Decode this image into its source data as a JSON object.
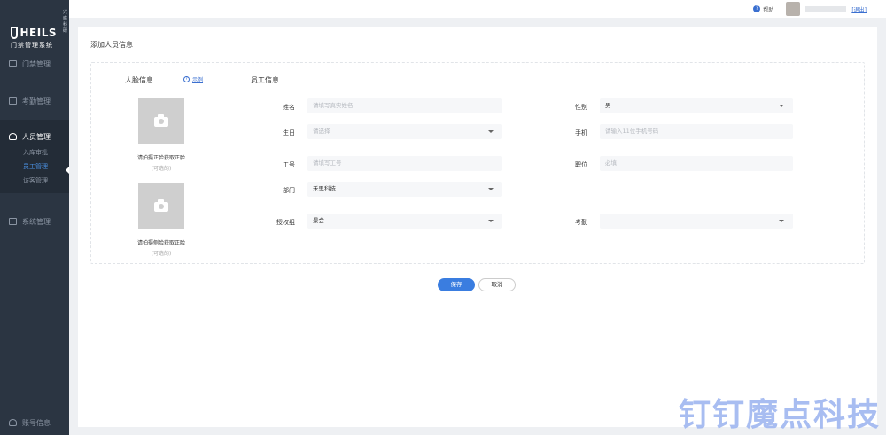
{
  "app": {
    "brand": "HEILS",
    "brand_tagline": "兴盛科研",
    "system_name": "门禁管理系统"
  },
  "sidebar": {
    "items": [
      {
        "label": "门禁管理"
      },
      {
        "label": "考勤管理"
      },
      {
        "label": "人员管理",
        "active": true
      },
      {
        "label": "系统管理"
      }
    ],
    "sub_items": [
      {
        "label": "入库审批"
      },
      {
        "label": "员工管理",
        "active": true
      },
      {
        "label": "访客管理"
      }
    ],
    "bottom_item": "账号信息"
  },
  "topbar": {
    "help_label": "帮助",
    "logout_label": "[退出]"
  },
  "page": {
    "title": "添加人员信息"
  },
  "face_section": {
    "title": "人脸信息",
    "example_label": "示例",
    "photo1_label": "请拍摄正脸获取正脸",
    "photo1_optional": "(可选的)",
    "photo2_label": "请拍摄侧脸获取正脸",
    "photo2_optional": "(可选的)"
  },
  "employee_section": {
    "title": "员工信息",
    "fields": {
      "name": {
        "label": "姓名",
        "placeholder": "请填写真实姓名"
      },
      "gender": {
        "label": "性别",
        "value": "男"
      },
      "birthday": {
        "label": "生日",
        "placeholder": "请选择"
      },
      "phone": {
        "label": "手机",
        "placeholder": "请输入11位手机号码"
      },
      "employee_id": {
        "label": "工号",
        "placeholder": "请填写工号"
      },
      "position": {
        "label": "职位",
        "placeholder": "必填"
      },
      "department": {
        "label": "部门",
        "value": "禾思科技"
      },
      "auth_group": {
        "label": "授权组",
        "value": "景会"
      },
      "attendance": {
        "label": "考勤",
        "value": ""
      }
    }
  },
  "actions": {
    "save": "保存",
    "cancel": "取消"
  },
  "watermark": "钉钉魔点科技",
  "colors": {
    "sidebar_bg": "#2b3542",
    "accent": "#3a7de0",
    "watermark": "#9fb6f0"
  }
}
